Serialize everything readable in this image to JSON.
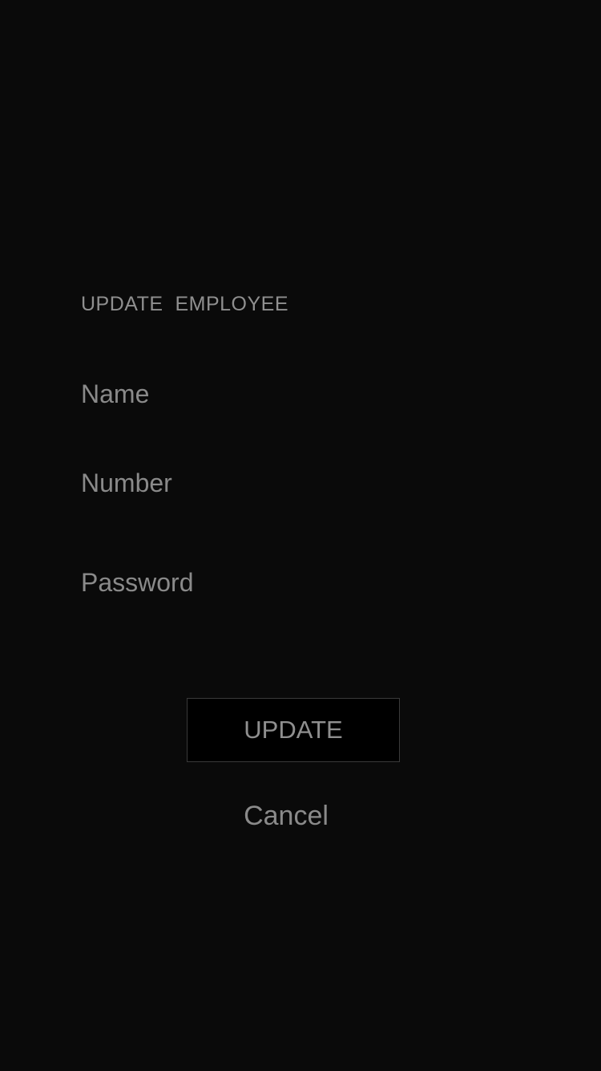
{
  "form": {
    "title": "UPDATE  EMPLOYEE",
    "fields": {
      "name": {
        "placeholder": "Name",
        "value": ""
      },
      "number": {
        "placeholder": "Number",
        "value": ""
      },
      "password": {
        "placeholder": "Password",
        "value": ""
      }
    },
    "update_label": "UPDATE",
    "cancel_label": "Cancel"
  },
  "colors": {
    "background": "#0a0a0a",
    "text": "#8a8a8a",
    "button_background": "#000000",
    "button_border": "#3a3a3a"
  }
}
